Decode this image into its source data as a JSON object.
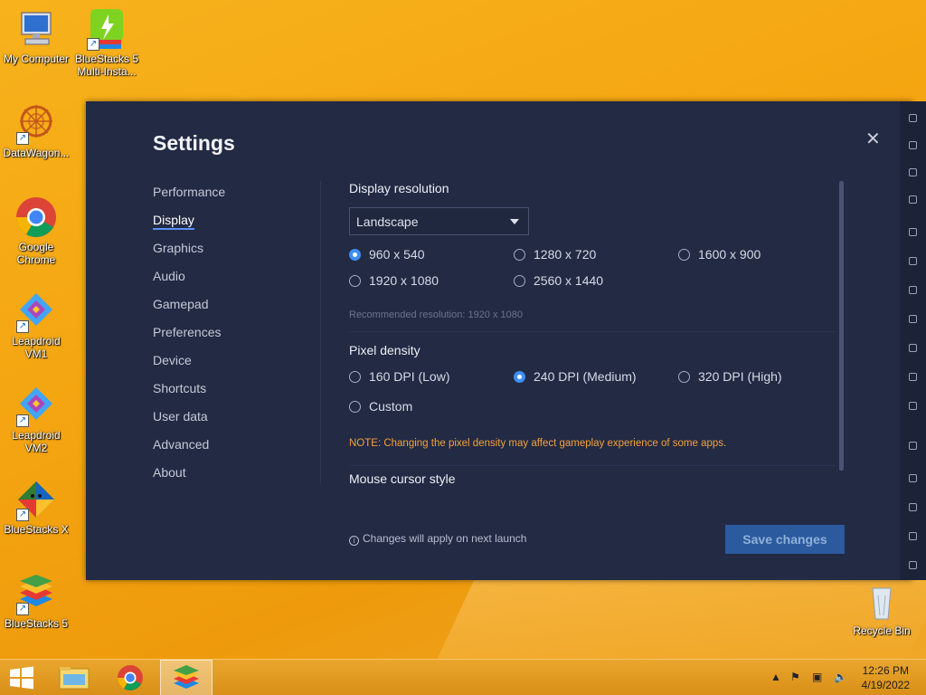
{
  "desktop": {
    "icons": [
      {
        "label": "My Computer",
        "icon": "computer-icon"
      },
      {
        "label": "BlueStacks 5 Multi-Insta...",
        "icon": "bluestacks-multi-instance-icon"
      },
      {
        "label": "DataWagon...",
        "icon": "datawagon-icon"
      },
      {
        "label": "Google Chrome",
        "icon": "chrome-icon"
      },
      {
        "label": "Leapdroid VM1",
        "icon": "leapdroid-icon"
      },
      {
        "label": "Leapdroid VM2",
        "icon": "leapdroid-icon"
      },
      {
        "label": "BlueStacks X",
        "icon": "bluestacks-x-icon"
      },
      {
        "label": "BlueStacks 5",
        "icon": "bluestacks-icon"
      },
      {
        "label": "Recycle Bin",
        "icon": "recycle-bin-icon"
      }
    ]
  },
  "settings": {
    "title": "Settings",
    "close_glyph": "✕",
    "nav": [
      {
        "label": "Performance",
        "active": false
      },
      {
        "label": "Display",
        "active": true
      },
      {
        "label": "Graphics",
        "active": false
      },
      {
        "label": "Audio",
        "active": false
      },
      {
        "label": "Gamepad",
        "active": false
      },
      {
        "label": "Preferences",
        "active": false
      },
      {
        "label": "Device",
        "active": false
      },
      {
        "label": "Shortcuts",
        "active": false
      },
      {
        "label": "User data",
        "active": false
      },
      {
        "label": "Advanced",
        "active": false
      },
      {
        "label": "About",
        "active": false
      }
    ],
    "display_resolution": {
      "title": "Display resolution",
      "orientation": "Landscape",
      "options": [
        {
          "label": "960 x 540",
          "selected": true
        },
        {
          "label": "1280 x 720",
          "selected": false
        },
        {
          "label": "1600 x 900",
          "selected": false
        },
        {
          "label": "1920 x 1080",
          "selected": false
        },
        {
          "label": "2560 x 1440",
          "selected": false
        }
      ],
      "recommended": "Recommended resolution: 1920 x 1080"
    },
    "pixel_density": {
      "title": "Pixel density",
      "options": [
        {
          "label": "160 DPI (Low)",
          "selected": false
        },
        {
          "label": "240 DPI (Medium)",
          "selected": true
        },
        {
          "label": "320 DPI (High)",
          "selected": false
        },
        {
          "label": "Custom",
          "selected": false
        }
      ],
      "note": "NOTE: Changing the pixel density may affect gameplay experience of some apps."
    },
    "mouse_cursor": {
      "title": "Mouse cursor style"
    },
    "footer_info": "Changes will apply on next launch",
    "save_label": "Save changes"
  },
  "taskbar": {
    "time": "12:26 PM",
    "date": "4/19/2022"
  },
  "colors": {
    "accent": "#3d8ff5",
    "panel": "#222a44",
    "note": "#f2a23b",
    "save_button": "#2c5a9e"
  }
}
